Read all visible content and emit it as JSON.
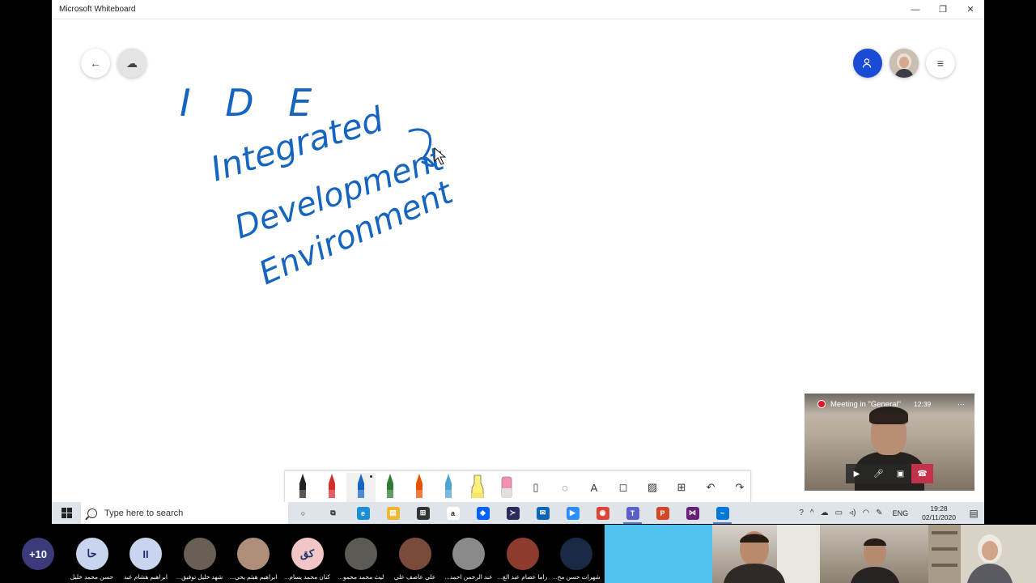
{
  "window": {
    "title": "Microsoft Whiteboard",
    "minimize": "—",
    "restore": "❐",
    "close": "✕"
  },
  "board": {
    "back_icon": "←",
    "sync_icon": "☁",
    "handwriting": {
      "line1": "I D E",
      "line2": "Integrated",
      "line3": "Development",
      "line4": "Environment"
    },
    "ink_color": "#1565c0",
    "invite_icon": "person-add",
    "menu_icon": "≡"
  },
  "toolbar": {
    "pens": [
      {
        "name": "black-pen",
        "color": "#222222"
      },
      {
        "name": "red-pen",
        "color": "#d32f2f"
      },
      {
        "name": "blue-pen",
        "color": "#1565c0",
        "selected": true
      },
      {
        "name": "green-pen",
        "color": "#2e7d32"
      },
      {
        "name": "orange-pen",
        "color": "#e65100"
      },
      {
        "name": "lightblue-pen",
        "color": "#4fa3d1"
      },
      {
        "name": "highlighter",
        "color": "#fff176"
      },
      {
        "name": "eraser",
        "color": "#f48fb1"
      }
    ],
    "tools": [
      {
        "name": "ruler-tool",
        "glyph": "▯"
      },
      {
        "name": "lasso-tool",
        "glyph": "◌"
      },
      {
        "name": "text-tool",
        "glyph": "A"
      },
      {
        "name": "note-tool",
        "glyph": "◻"
      },
      {
        "name": "image-tool",
        "glyph": "▨"
      },
      {
        "name": "insert-tool",
        "glyph": "⊞"
      },
      {
        "name": "undo-tool",
        "glyph": "↶"
      },
      {
        "name": "redo-tool",
        "glyph": "↷"
      }
    ]
  },
  "taskbar": {
    "search_placeholder": "Type here to search",
    "apps": [
      {
        "name": "cortana",
        "glyph": "○",
        "color": "transparent"
      },
      {
        "name": "task-view",
        "glyph": "⧉",
        "color": "transparent"
      },
      {
        "name": "edge",
        "glyph": "e",
        "color": "#1a8fd8"
      },
      {
        "name": "file-explorer",
        "glyph": "▤",
        "color": "#f2b632"
      },
      {
        "name": "store",
        "glyph": "⊞",
        "color": "#333333"
      },
      {
        "name": "amazon",
        "glyph": "a",
        "color": "#ffffff"
      },
      {
        "name": "dropbox",
        "glyph": "◆",
        "color": "#0061fe"
      },
      {
        "name": "visual-studio-code",
        "glyph": "≻",
        "color": "#2b2b5e"
      },
      {
        "name": "mail",
        "glyph": "✉",
        "color": "#0a64b7"
      },
      {
        "name": "zoom",
        "glyph": "▶",
        "color": "#2d8cff"
      },
      {
        "name": "chrome",
        "glyph": "◉",
        "color": "#db4437"
      },
      {
        "name": "teams",
        "glyph": "T",
        "color": "#5b5fc7"
      },
      {
        "name": "powerpoint",
        "glyph": "P",
        "color": "#d24726"
      },
      {
        "name": "visual-studio",
        "glyph": "⋈",
        "color": "#68217a"
      },
      {
        "name": "whiteboard",
        "glyph": "~",
        "color": "#0078d4"
      }
    ],
    "language": "ENG",
    "time": "19:28",
    "date": "02/11/2020"
  },
  "meeting": {
    "label": "Meeting in \"General\"",
    "duration": "12:39",
    "more": "···"
  },
  "participants": [
    {
      "initials": "+10",
      "name": "",
      "color": "#3b3a7a"
    },
    {
      "initials": "حا",
      "name": "حسن محمد خليل",
      "color": "#c9d4ee"
    },
    {
      "initials": "II",
      "name": "ابراهيم هشام عبد",
      "color": "#c9d4ee"
    },
    {
      "initials": "",
      "name": "شهد خليل توفيق...",
      "color": "#6a5f55"
    },
    {
      "initials": "",
      "name": "ابراهيم هيثم يحي...",
      "color": "#b08f7a"
    },
    {
      "initials": "كق",
      "name": "كنان محمد يسام...",
      "color": "#f1c6c6"
    },
    {
      "initials": "",
      "name": "ليث محمد محمو...",
      "color": "#5d5a55"
    },
    {
      "initials": "",
      "name": "علي عاصف علي",
      "color": "#7a4a3a"
    },
    {
      "initials": "",
      "name": "عبد الرحمن احمد...",
      "color": "#8a8a8a"
    },
    {
      "initials": "",
      "name": "راما عصام عبد الغ...",
      "color": "#8c3b2e"
    },
    {
      "initials": "",
      "name": "شهرات حسن مح...",
      "color": "#1b2a44"
    }
  ]
}
